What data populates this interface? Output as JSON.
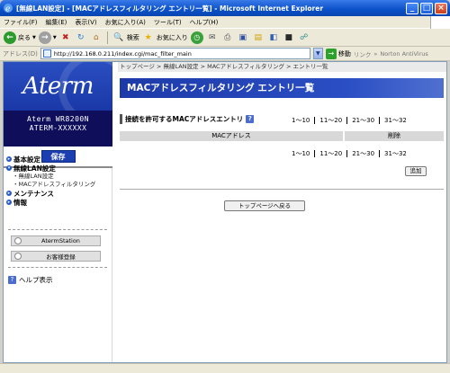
{
  "window": {
    "title": "[無線LAN設定] - [MACアドレスフィルタリング エントリ一覧] - Microsoft Internet Explorer",
    "minimize": "_",
    "maximize": "□",
    "close": "×"
  },
  "menu": [
    "ファイル(F)",
    "編集(E)",
    "表示(V)",
    "お気に入り(A)",
    "ツール(T)",
    "ヘルプ(H)"
  ],
  "toolbar": {
    "back_label": "戻る",
    "search_label": "検索",
    "favorites_label": "お気に入り"
  },
  "addressbar": {
    "label": "アドレス(D)",
    "url": "http://192.168.0.211/index.cgi/mac_filter_main",
    "go_label": "移動",
    "links_label": "リンク",
    "antivirus_label": "Norton AntiVirus"
  },
  "sidebar": {
    "logo": "Aterm",
    "model_line1": "Aterm WR8200N",
    "model_line2": "ATERM-XXXXXX",
    "save_label": "保存",
    "nav": {
      "basic": "基本設定",
      "wlan": "無線LAN設定",
      "wlan_sub1": "・無線LAN設定",
      "wlan_sub2": "・MACアドレスフィルタリング",
      "maintenance": "メンテナンス",
      "info": "情報"
    },
    "aterm_station": "AtermStation",
    "customer_reg": "お客様登録",
    "help": "ヘルプ表示"
  },
  "main": {
    "breadcrumb": "トップページ > 無線LAN設定 > MACアドレスフィルタリング > エントリ一覧",
    "title": "MACアドレスフィルタリング エントリ一覧",
    "section_title": "接続を許可するMACアドレスエントリ",
    "help_icon": "?",
    "pager": [
      "1～10",
      "11～20",
      "21～30",
      "31～32"
    ],
    "col_mac": "MACアドレス",
    "col_delete": "削除",
    "add_label": "追加",
    "back_top_label": "トップページへ戻る"
  }
}
